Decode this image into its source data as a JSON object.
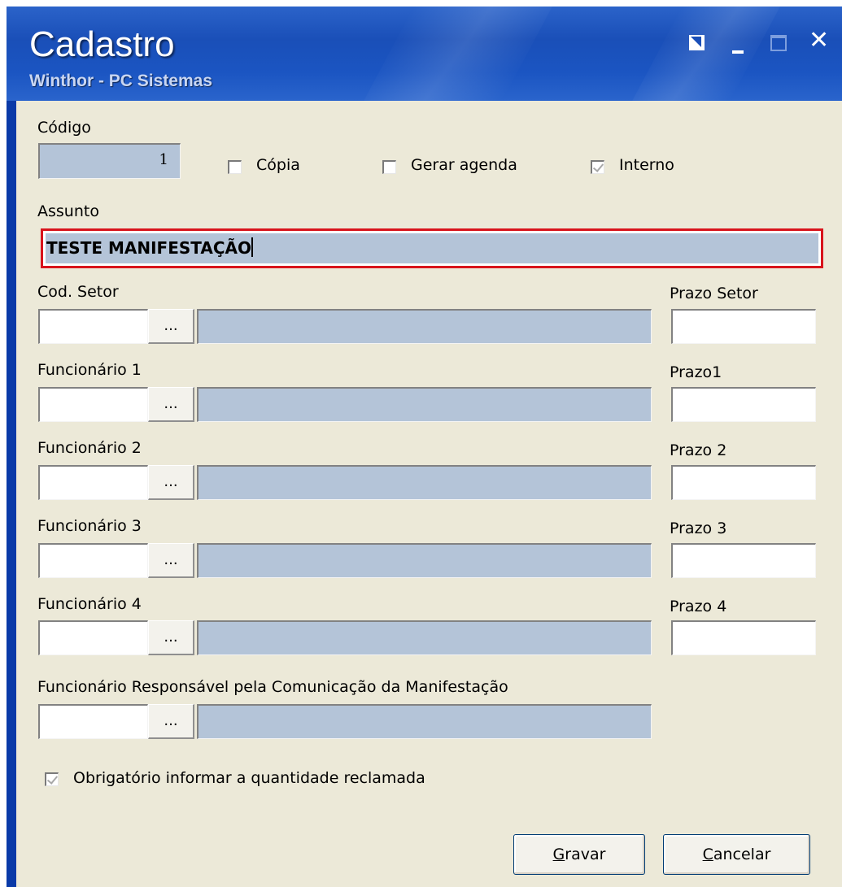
{
  "window": {
    "title": "Cadastro",
    "subtitle": "Winthor - PC Sistemas",
    "icons": [
      "edit-icon",
      "minimize-icon",
      "maximize-icon",
      "close-icon"
    ]
  },
  "form": {
    "codigo_label": "Código",
    "codigo_value": "1",
    "copia_label": "Cópia",
    "copia_checked": false,
    "gerar_agenda_label": "Gerar agenda",
    "gerar_agenda_checked": false,
    "interno_label": "Interno",
    "interno_checked": true,
    "assunto_label": "Assunto",
    "assunto_value": "TESTE MANIFESTAÇÃO",
    "cod_setor_label": "Cod. Setor",
    "prazo_setor_label": "Prazo Setor",
    "funcionario1_label": "Funcionário 1",
    "prazo1_label": "Prazo1",
    "funcionario2_label": "Funcionário 2",
    "prazo2_label": "Prazo 2",
    "funcionario3_label": "Funcionário 3",
    "prazo3_label": "Prazo 3",
    "funcionario4_label": "Funcionário 4",
    "prazo4_label": "Prazo 4",
    "responsavel_label": "Funcionário Responsável pela Comunicação da Manifestação",
    "ellipsis_label": "...",
    "obrigatorio_label": "Obrigatório informar a quantidade reclamada",
    "obrigatorio_checked": true
  },
  "buttons": {
    "gravar_prefix": "",
    "gravar_hotkey": "G",
    "gravar_rest": "ravar",
    "cancelar_prefix": "",
    "cancelar_hotkey": "C",
    "cancelar_rest": "ancelar"
  },
  "colors": {
    "titlebar": "#1a4fb8",
    "client_bg": "#ece9d8",
    "readonly_field": "#b4c4d8",
    "highlight_border": "#d8141c"
  }
}
